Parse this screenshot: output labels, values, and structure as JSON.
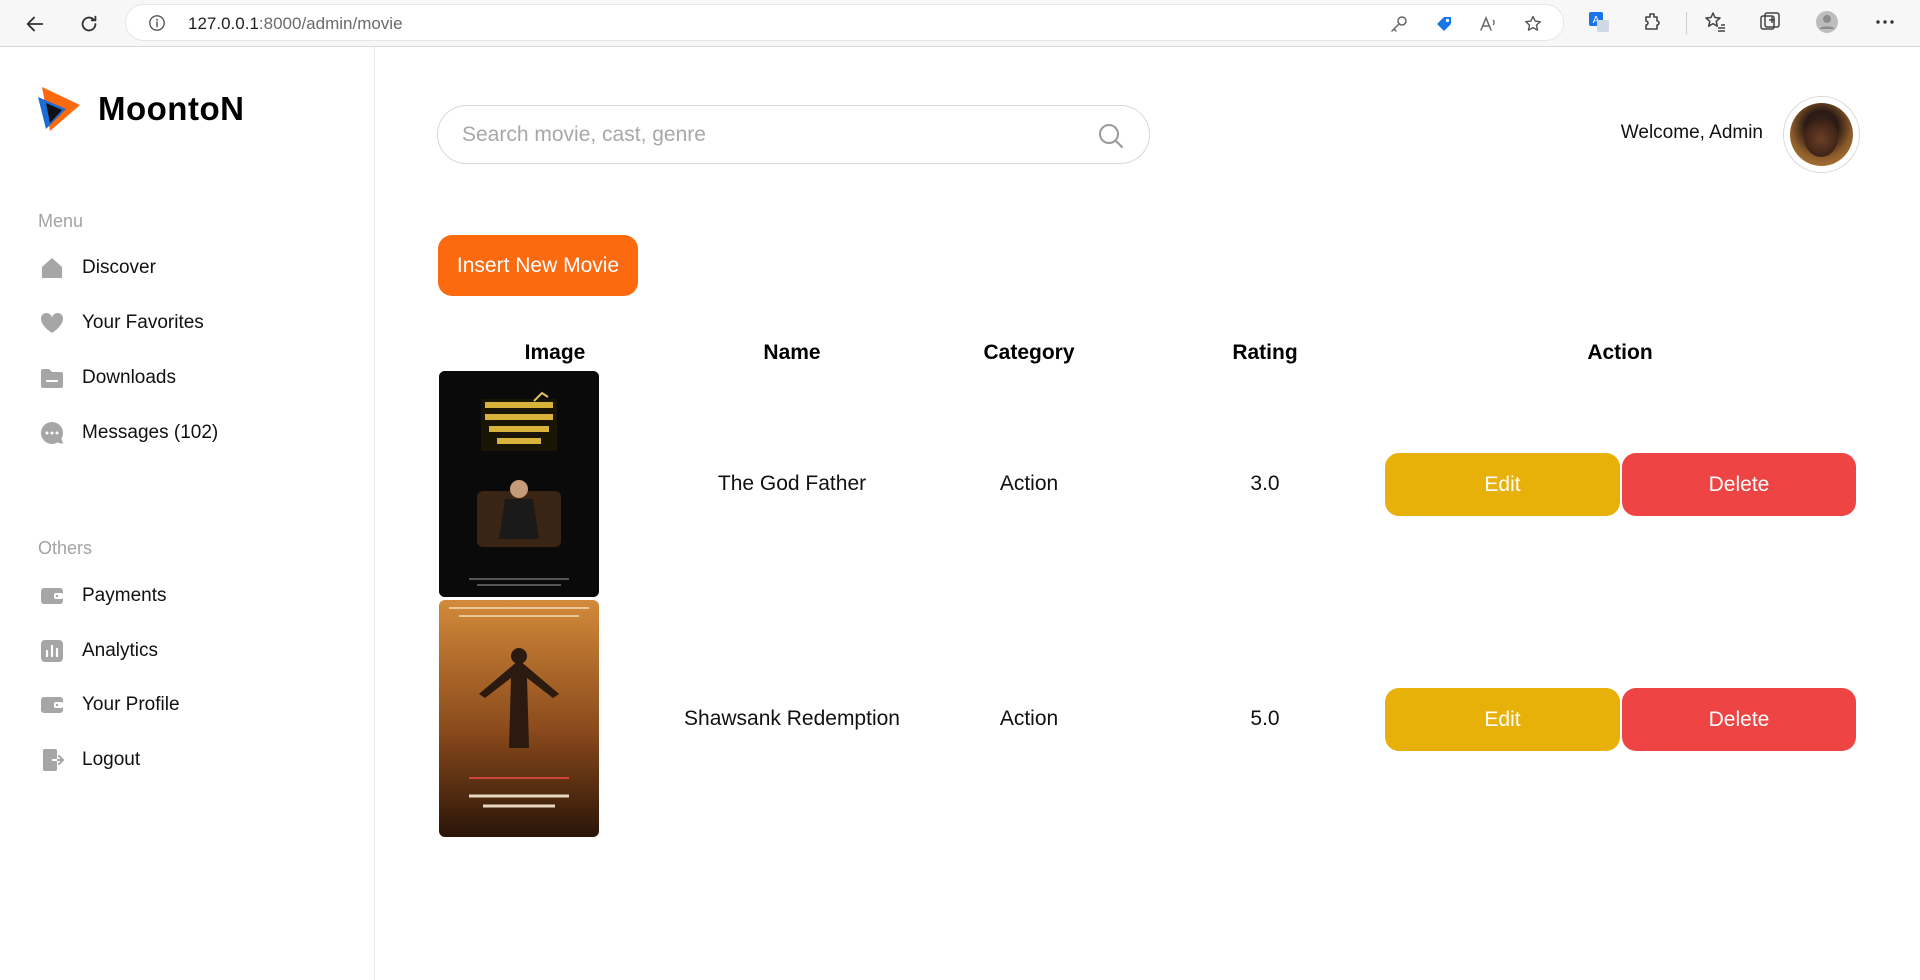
{
  "browser": {
    "url_host": "127.0.0.1",
    "url_path": ":8000/admin/movie"
  },
  "brand": {
    "name": "MoontoN",
    "colors": {
      "orange": "#fc6a0f",
      "blue": "#1c6bd6",
      "dark": "#111111"
    }
  },
  "sidebar": {
    "menu_label": "Menu",
    "menu_items": [
      {
        "label": "Discover",
        "icon": "home-icon"
      },
      {
        "label": "Your Favorites",
        "icon": "heart-icon"
      },
      {
        "label": "Downloads",
        "icon": "folder-icon"
      },
      {
        "label": "Messages (102)",
        "icon": "chat-icon"
      }
    ],
    "others_label": "Others",
    "others_items": [
      {
        "label": "Payments",
        "icon": "wallet-icon"
      },
      {
        "label": "Analytics",
        "icon": "chart-icon"
      },
      {
        "label": "Your Profile",
        "icon": "profile-card-icon"
      },
      {
        "label": "Logout",
        "icon": "logout-icon"
      }
    ]
  },
  "header": {
    "search_placeholder": "Search movie, cast, genre",
    "welcome": "Welcome, Admin"
  },
  "actions": {
    "insert_label": "Insert New Movie"
  },
  "table": {
    "columns": [
      "Image",
      "Name",
      "Category",
      "Rating",
      "Action"
    ],
    "rows": [
      {
        "poster": "The Godfather Part II poster",
        "name": "The God Father",
        "category": "Action",
        "rating": "3.0",
        "edit_label": "Edit",
        "delete_label": "Delete"
      },
      {
        "poster": "The Shawshank Redemption poster",
        "name": "Shawsank Redemption",
        "category": "Action",
        "rating": "5.0",
        "edit_label": "Edit",
        "delete_label": "Delete"
      }
    ]
  },
  "colors": {
    "edit_button": "#e8b10a",
    "delete_button": "#ef4444",
    "insert_button": "#fc6a0f",
    "sidebar_icon": "#a6a6a6"
  }
}
